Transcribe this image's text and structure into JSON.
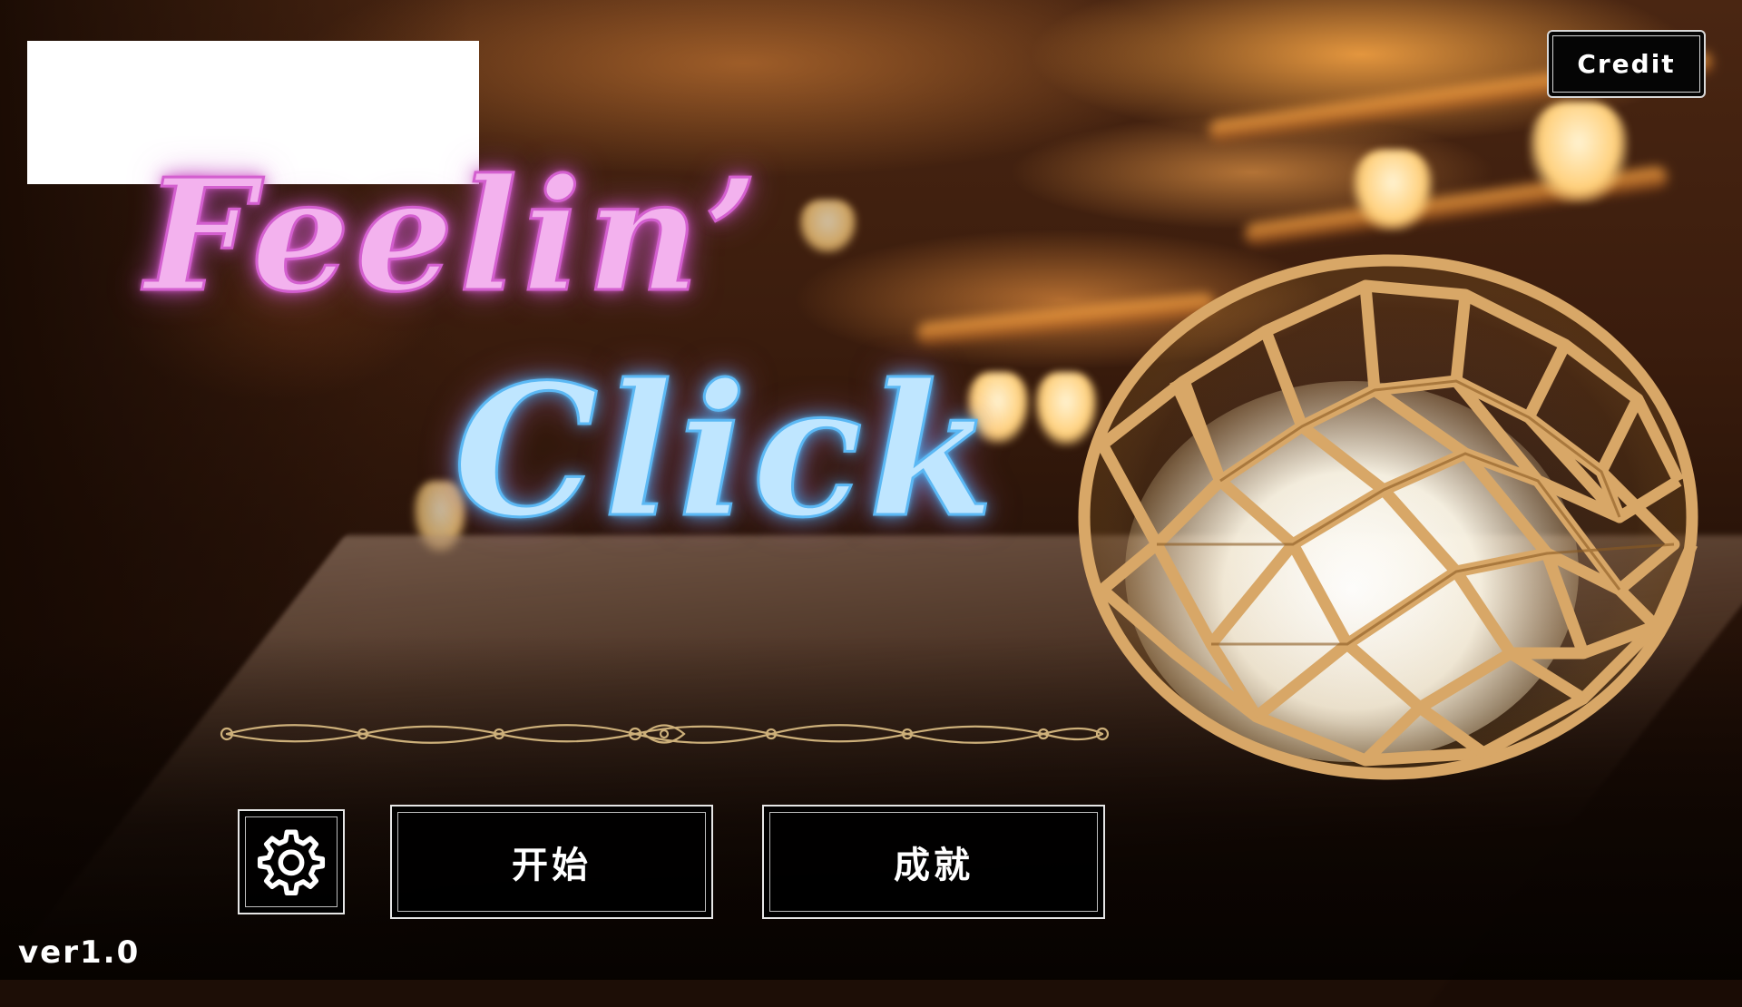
{
  "title": {
    "line1": "Feelin’",
    "line2": "Click"
  },
  "header": {
    "credit_label": "Credit"
  },
  "menu": {
    "start_label": "开始",
    "achievements_label": "成就",
    "settings_icon": "gear-icon"
  },
  "footer": {
    "version": "ver1.0"
  },
  "colors": {
    "title_line1": "#f3b2ee",
    "title_line2": "#bfe6ff",
    "button_bg": "#000000",
    "button_border": "#e6e6e6",
    "ornament": "#cdb07a"
  }
}
